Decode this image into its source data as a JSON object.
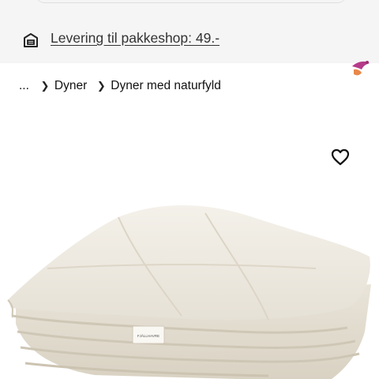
{
  "delivery": {
    "icon": "delivery-box-icon",
    "label": "Levering til pakkeshop: 49.-"
  },
  "breadcrumb": {
    "ellipsis": "...",
    "separator_icon": "chevron-right-icon",
    "items": [
      {
        "label": "Dyner"
      },
      {
        "label": "Dyner med naturfyld"
      }
    ]
  },
  "product": {
    "favorite_icon": "heart-outline-icon",
    "image": "duvet-product-image",
    "tag_text": "FJÄLLHAVRE"
  },
  "colors": {
    "bar_background": "#f5f5f5",
    "text": "#111111",
    "link": "#333333",
    "deco_purple": "#b53b8a",
    "deco_orange": "#e8884a"
  }
}
